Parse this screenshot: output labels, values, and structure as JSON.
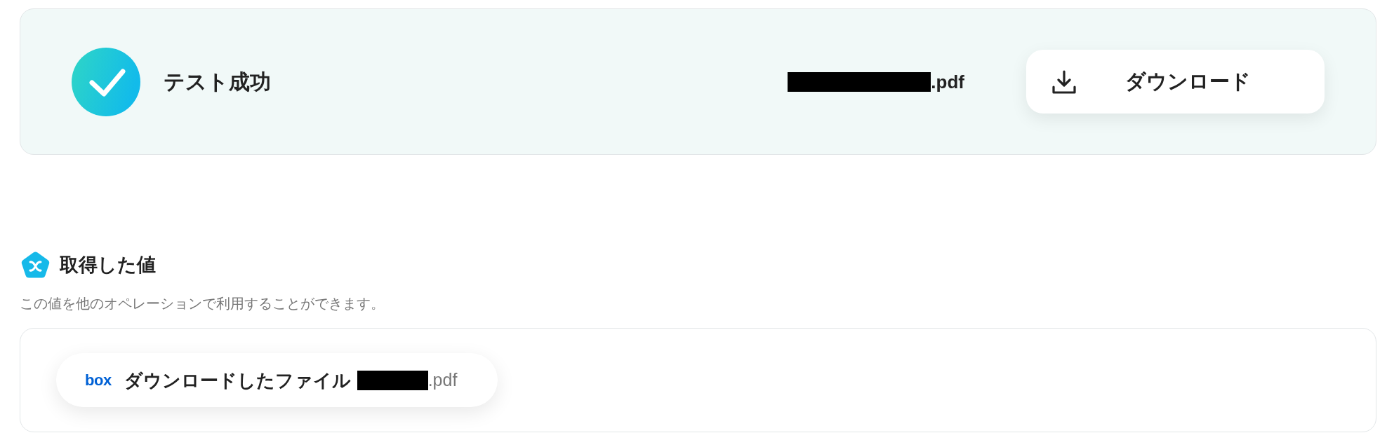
{
  "result": {
    "kind": "success",
    "status_text": "テスト成功",
    "file_name": {
      "redacted": true,
      "visible_text": ".pdf"
    },
    "download_button": "ダウンロード"
  },
  "values_section": {
    "title": "取得した値",
    "description": "この値を他のオペレーションで利用することができます。",
    "values": [
      {
        "source_logo": "box",
        "label": "ダウンロードしたファイル",
        "value": {
          "redacted": true,
          "visible_text": ".pdf"
        }
      }
    ]
  }
}
